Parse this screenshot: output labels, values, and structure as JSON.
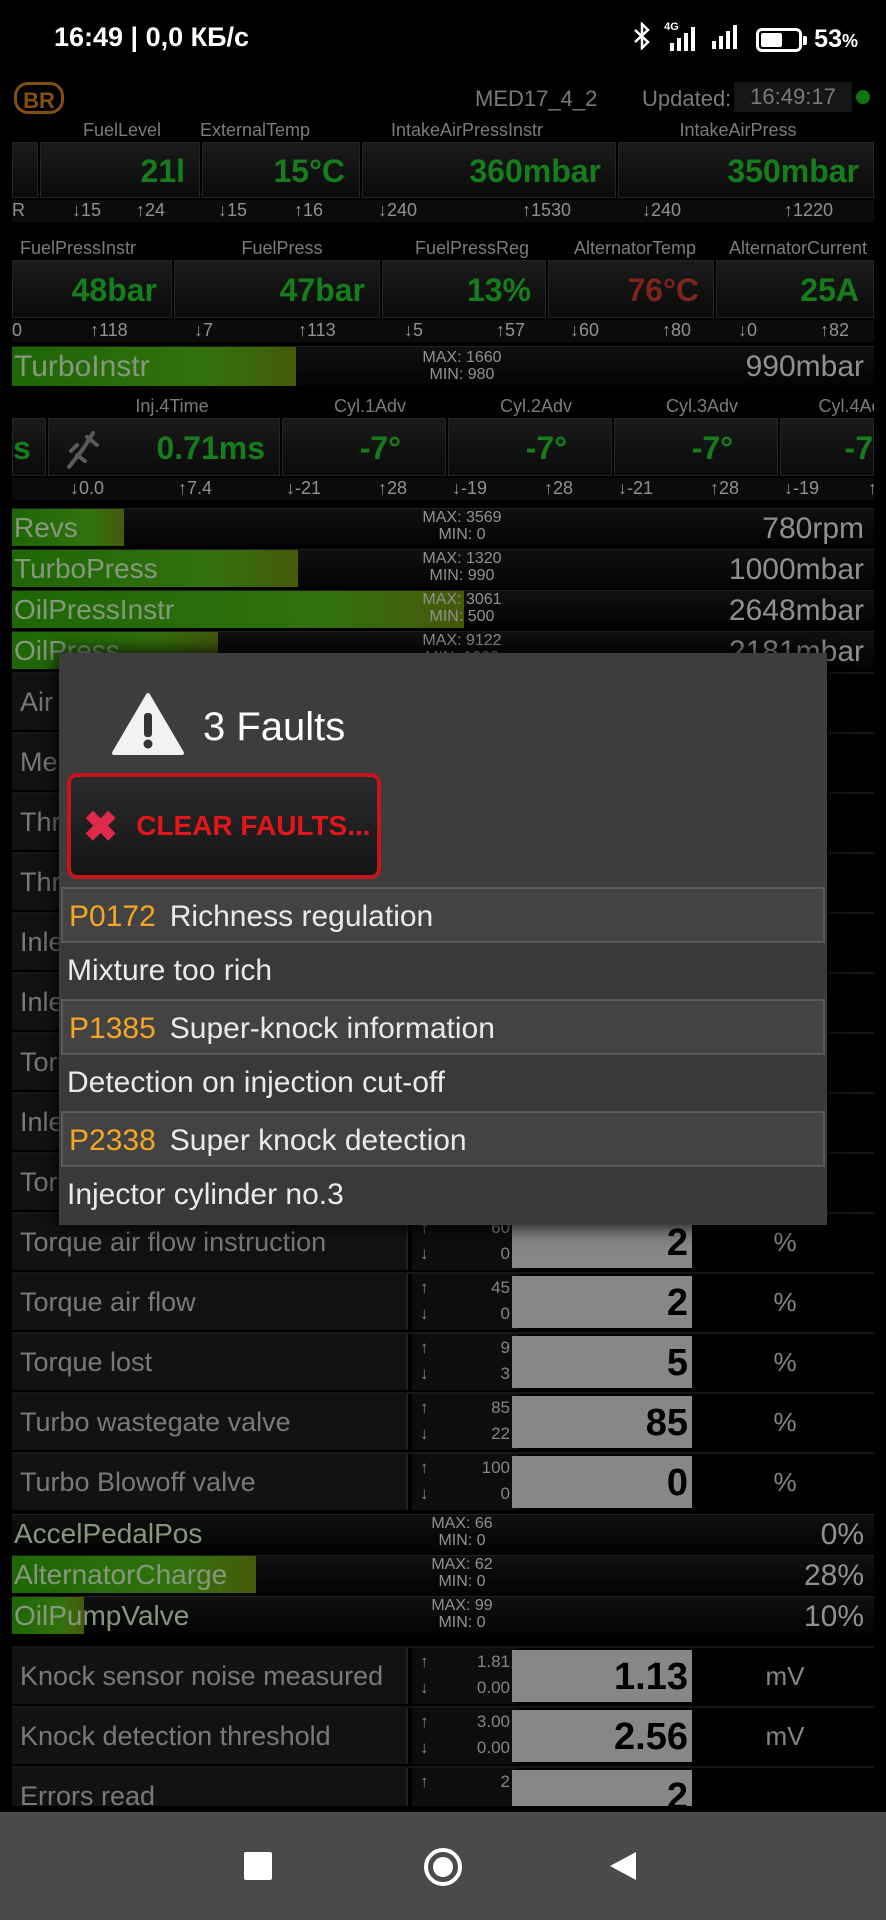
{
  "status_bar": {
    "time": "16:49 | 0,0 КБ/с",
    "battery": "53",
    "battery_unit": "%",
    "network": "4G"
  },
  "header": {
    "badge": "BR",
    "ecu": "MED17_4_2",
    "updated_label": "Updated:",
    "updated_time": "16:49:17"
  },
  "gauge_row1": {
    "labels": [
      "FuelLevel",
      "ExternalTemp",
      "IntakeAirPressInstr",
      "IntakeAirPress"
    ],
    "values": [
      "21l",
      "15°C",
      "360mbar",
      "350mbar"
    ],
    "minmax": [
      "R",
      "↓15",
      "↑24",
      "↓15",
      "↑16",
      "↓240",
      "↑1530",
      "↓240",
      "↑1220"
    ]
  },
  "gauge_row2": {
    "labels": [
      "FuelPressInstr",
      "FuelPress",
      "FuelPressReg",
      "AlternatorTemp",
      "AlternatorCurrent"
    ],
    "values": [
      "48bar",
      "47bar",
      "13%",
      "76°C",
      "25A"
    ],
    "minmax": [
      "0",
      "↑118",
      "↓7",
      "↑113",
      "↓5",
      "↑57",
      "↓60",
      "↑80",
      "↓0",
      "↑82"
    ]
  },
  "turbo_bar": {
    "name": "TurboInstr",
    "max": "MAX: 1660",
    "min": "MIN: 980",
    "value": "990mbar",
    "fill": 0.28
  },
  "gauge_row3": {
    "labels": [
      "Inj.4Time",
      "Cyl.1Adv",
      "Cyl.2Adv",
      "Cyl.3Adv",
      "Cyl.4Ad"
    ],
    "first": "s",
    "values": [
      "0.71ms",
      "-7°",
      "-7°",
      "-7°",
      "-7"
    ],
    "minmax": [
      "↓0.0",
      "↑7.4",
      "↓-21",
      "↑28",
      "↓-19",
      "↑28",
      "↓-21",
      "↑28",
      "↓-19",
      "↑"
    ]
  },
  "bars": [
    {
      "name": "Revs",
      "max": "MAX: 3569",
      "min": "MIN: 0",
      "value": "780rpm",
      "fill": 0.11
    },
    {
      "name": "TurboPress",
      "max": "MAX: 1320",
      "min": "MIN: 990",
      "value": "1000mbar",
      "fill": 0.27
    },
    {
      "name": "OilPressInstr",
      "max": "MAX: 3061",
      "min": "MIN: 500",
      "value": "2648mbar",
      "fill": 0.43
    },
    {
      "name": "OilPress",
      "max": "MAX: 9122",
      "min": "MIN: 1000",
      "value": "2181mbar",
      "fill": 0.2
    }
  ],
  "hidden_rows": [
    "Air",
    "Me",
    "Thr",
    "Thr",
    "Inle",
    "Inle",
    "Tor",
    "Inle",
    "Tor"
  ],
  "params1": [
    {
      "name": "Torque air flow instruction",
      "up": "60",
      "down": "0",
      "value": "2",
      "unit": "%"
    },
    {
      "name": "Torque air flow",
      "up": "45",
      "down": "0",
      "value": "2",
      "unit": "%"
    },
    {
      "name": "Torque lost",
      "up": "9",
      "down": "3",
      "value": "5",
      "unit": "%"
    },
    {
      "name": "Turbo wastegate valve",
      "up": "85",
      "down": "22",
      "value": "85",
      "unit": "%"
    },
    {
      "name": "Turbo Blowoff valve",
      "up": "100",
      "down": "0",
      "value": "0",
      "unit": "%"
    }
  ],
  "bars2": [
    {
      "name": "AccelPedalPos",
      "max": "MAX: 66",
      "min": "MIN: 0",
      "value": "0%",
      "fill": 0.0
    },
    {
      "name": "AlternatorCharge",
      "max": "MAX: 62",
      "min": "MIN: 0",
      "value": "28%",
      "fill": 0.29
    },
    {
      "name": "OilPumpValve",
      "max": "MAX: 99",
      "min": "MIN: 0",
      "value": "10%",
      "fill": 0.1
    }
  ],
  "params2": [
    {
      "name": "Knock sensor noise measured",
      "up": "1.81",
      "down": "0.00",
      "value": "1.13",
      "unit": "mV"
    },
    {
      "name": "Knock detection threshold",
      "up": "3.00",
      "down": "0.00",
      "value": "2.56",
      "unit": "mV"
    },
    {
      "name": "Errors read",
      "up": "2",
      "down": "",
      "value": "2",
      "unit": ""
    }
  ],
  "dialog": {
    "title": "3 Faults",
    "clear_label": "CLEAR FAULTS...",
    "faults": [
      {
        "code": "P0172",
        "title": "Richness regulation",
        "detail": "Mixture too rich"
      },
      {
        "code": "P1385",
        "title": "Super-knock information",
        "detail": "Detection on injection cut-off"
      },
      {
        "code": "P2338",
        "title": "Super knock detection",
        "detail": "Injector cylinder no.3"
      }
    ]
  },
  "colors": {
    "accent_green": "#22c02a",
    "warning_red": "#c0392b",
    "fault_code": "#f5a623",
    "clear_red": "#e3161c"
  }
}
